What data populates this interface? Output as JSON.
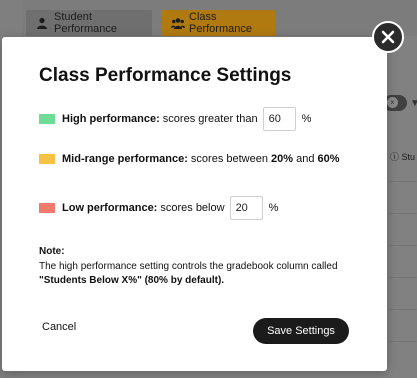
{
  "background": {
    "tabs": [
      {
        "label": "Student Performance",
        "icon": "user-icon"
      },
      {
        "label": "Class Performance",
        "icon": "users-icon"
      }
    ],
    "column_header_partial": "Stu"
  },
  "modal": {
    "title": "Class Performance Settings",
    "high": {
      "label": "High performance:",
      "text": "scores greater than",
      "value": "60",
      "unit": "%",
      "color": "#6fdc96"
    },
    "mid": {
      "label": "Mid-range performance:",
      "text": "scores between",
      "low": "20%",
      "and": "and",
      "high": "60%",
      "color": "#f7c244"
    },
    "low": {
      "label": "Low performance:",
      "text": "scores below",
      "value": "20",
      "unit": "%",
      "color": "#f07a6e"
    },
    "note": {
      "title": "Note:",
      "text": "The high performance setting controls the gradebook column called",
      "bold": "\"Students Below X%\" (80% by default)."
    },
    "cancel_label": "Cancel",
    "save_label": "Save Settings"
  }
}
